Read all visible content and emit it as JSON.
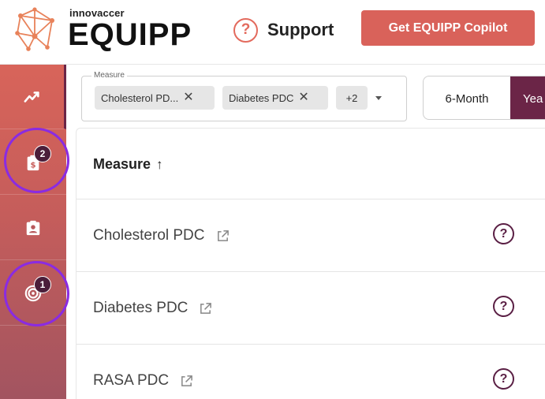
{
  "brand": {
    "company": "innovaccer",
    "product": "EQUIPP"
  },
  "header": {
    "support_label": "Support",
    "support_icon": "question-circle-icon",
    "copilot_button": "Get EQUIPP Copilot",
    "accent_color": "#d9625a"
  },
  "sidebar": {
    "items": [
      {
        "icon": "trend-chart-icon",
        "badge": null
      },
      {
        "icon": "dollar-clipboard-icon",
        "badge": "2"
      },
      {
        "icon": "patient-clipboard-icon",
        "badge": null
      },
      {
        "icon": "target-icon",
        "badge": "1"
      }
    ],
    "badge_color": "#4a1e3a"
  },
  "filter": {
    "measure_label": "Measure",
    "chips": [
      "Cholesterol PD...",
      "Diabetes PDC"
    ],
    "more_count": "+2",
    "periods": [
      "6-Month",
      "Yea"
    ],
    "selected_period": "Yea",
    "selected_color": "#6b2547"
  },
  "table": {
    "column_header": "Measure",
    "sort_direction": "ascending",
    "rows": [
      {
        "name": "Cholesterol PDC"
      },
      {
        "name": "Diabetes PDC"
      },
      {
        "name": "RASA PDC"
      }
    ]
  }
}
